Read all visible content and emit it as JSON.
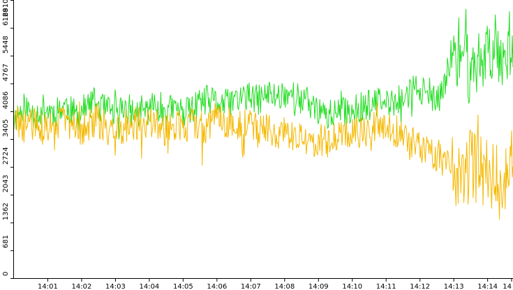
{
  "chart_data": {
    "type": "line",
    "title": "",
    "xlabel": "",
    "ylabel": "",
    "grid": false,
    "legend": "none",
    "ylim": [
      0,
      6810
    ],
    "y_ticks": [
      "0",
      "681",
      "1362",
      "2043",
      "2724",
      "3405",
      "4086",
      "4767",
      "5448",
      "6129",
      "6810"
    ],
    "x_ticks": [
      "14:01",
      "14:02",
      "14:03",
      "14:04",
      "14:05",
      "14:06",
      "14:07",
      "14:08",
      "14:09",
      "14:10",
      "14:11",
      "14:12",
      "14:13",
      "14:14",
      "14"
    ],
    "x_range_minutes": [
      0.0,
      14.75
    ],
    "series": [
      {
        "color": "#22dd22",
        "points": [
          [
            0.0,
            3900
          ],
          [
            0.3,
            4200
          ],
          [
            0.6,
            4000
          ],
          [
            0.9,
            4150
          ],
          [
            1.2,
            4050
          ],
          [
            1.5,
            4250
          ],
          [
            1.8,
            4000
          ],
          [
            2.1,
            4150
          ],
          [
            2.4,
            4300
          ],
          [
            2.7,
            4100
          ],
          [
            3.0,
            4050
          ],
          [
            3.3,
            4200
          ],
          [
            3.6,
            4000
          ],
          [
            3.9,
            4100
          ],
          [
            4.2,
            4250
          ],
          [
            4.5,
            4100
          ],
          [
            4.8,
            4150
          ],
          [
            5.1,
            4050
          ],
          [
            5.4,
            4200
          ],
          [
            5.7,
            4350
          ],
          [
            6.0,
            4300
          ],
          [
            6.3,
            4250
          ],
          [
            6.6,
            4400
          ],
          [
            6.9,
            4450
          ],
          [
            7.2,
            4350
          ],
          [
            7.5,
            4500
          ],
          [
            7.8,
            4450
          ],
          [
            8.1,
            4550
          ],
          [
            8.4,
            4400
          ],
          [
            8.7,
            4300
          ],
          [
            9.0,
            4100
          ],
          [
            9.3,
            4000
          ],
          [
            9.6,
            4050
          ],
          [
            9.9,
            4100
          ],
          [
            10.2,
            4150
          ],
          [
            10.5,
            4250
          ],
          [
            10.8,
            4300
          ],
          [
            11.1,
            4250
          ],
          [
            11.4,
            4350
          ],
          [
            11.7,
            4550
          ],
          [
            12.0,
            4700
          ],
          [
            12.3,
            4300
          ],
          [
            12.6,
            4400
          ],
          [
            12.9,
            5300
          ],
          [
            13.2,
            5600
          ],
          [
            13.5,
            5000
          ],
          [
            13.8,
            5400
          ],
          [
            14.1,
            5600
          ],
          [
            14.4,
            5500
          ],
          [
            14.7,
            5800
          ]
        ],
        "noise": 380,
        "seed": 11
      },
      {
        "color": "#f5b800",
        "points": [
          [
            0.0,
            3850
          ],
          [
            0.3,
            3700
          ],
          [
            0.6,
            3800
          ],
          [
            0.9,
            3600
          ],
          [
            1.2,
            3750
          ],
          [
            1.5,
            3900
          ],
          [
            1.8,
            3700
          ],
          [
            2.1,
            3650
          ],
          [
            2.4,
            3850
          ],
          [
            2.7,
            3700
          ],
          [
            3.0,
            3600
          ],
          [
            3.3,
            3750
          ],
          [
            3.6,
            3800
          ],
          [
            3.9,
            3700
          ],
          [
            4.2,
            3850
          ],
          [
            4.5,
            3600
          ],
          [
            4.8,
            3750
          ],
          [
            5.1,
            3700
          ],
          [
            5.4,
            3800
          ],
          [
            5.7,
            3650
          ],
          [
            6.0,
            3950
          ],
          [
            6.3,
            3850
          ],
          [
            6.6,
            3700
          ],
          [
            6.9,
            3800
          ],
          [
            7.2,
            3600
          ],
          [
            7.5,
            3700
          ],
          [
            7.8,
            3500
          ],
          [
            8.1,
            3550
          ],
          [
            8.4,
            3400
          ],
          [
            8.7,
            3300
          ],
          [
            9.0,
            3400
          ],
          [
            9.3,
            3350
          ],
          [
            9.6,
            3500
          ],
          [
            9.9,
            3600
          ],
          [
            10.2,
            3650
          ],
          [
            10.5,
            3700
          ],
          [
            10.8,
            3750
          ],
          [
            11.1,
            3700
          ],
          [
            11.4,
            3550
          ],
          [
            11.7,
            3300
          ],
          [
            12.0,
            3200
          ],
          [
            12.3,
            3100
          ],
          [
            12.6,
            3000
          ],
          [
            12.9,
            2600
          ],
          [
            13.2,
            2400
          ],
          [
            13.5,
            2800
          ],
          [
            13.8,
            2600
          ],
          [
            14.1,
            2400
          ],
          [
            14.4,
            2300
          ],
          [
            14.7,
            2500
          ]
        ],
        "noise": 420,
        "seed": 29
      }
    ]
  }
}
